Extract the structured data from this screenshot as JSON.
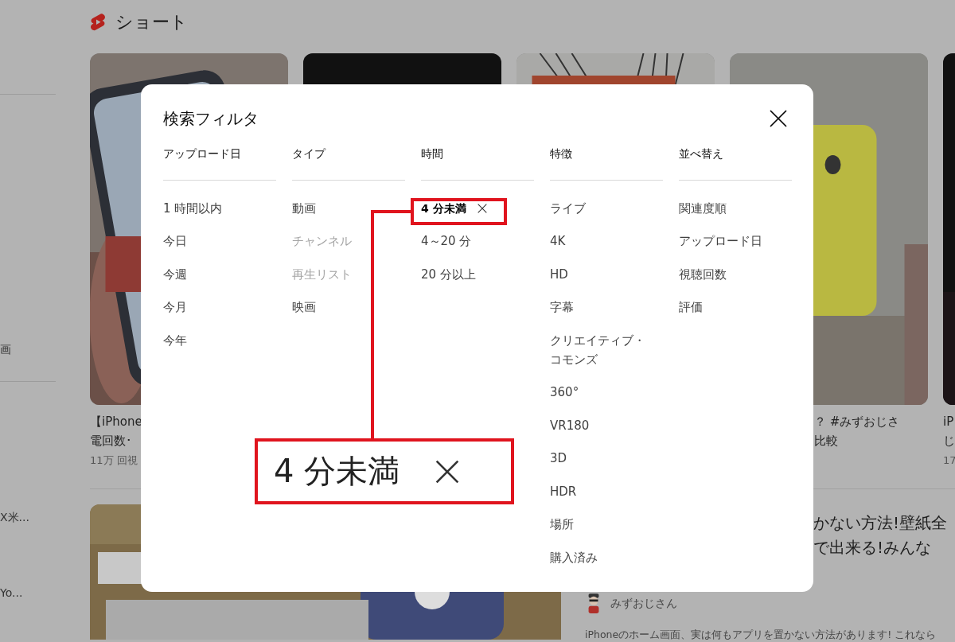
{
  "page": {
    "section_title": "ショート",
    "sidebar": [
      {
        "label": "画"
      },
      {
        "label": "X米..."
      },
      {
        "label": "Yo..."
      }
    ],
    "shorts": [
      {
        "kind": "phone-hand",
        "title_lines": [
          "【iPhone",
          "電回数･"
        ],
        "views": "11万 回視"
      },
      {
        "kind": "dark"
      },
      {
        "kind": "sketch"
      },
      {
        "kind": "yellow-phone",
        "title_lines": [
          "？ #みずおじさ",
          "比較"
        ]
      },
      {
        "kind": "dark",
        "title_lines": [
          "iP",
          "じ"
        ],
        "views": "17"
      }
    ],
    "video": {
      "kind": "poster",
      "title_lines": [
        "かない方法!壁紙全",
        "で出来る!みんな"
      ],
      "channel": "みずおじさん",
      "description": "iPhoneのホーム画面、実は何もアプリを置かない方法があります! これなら"
    }
  },
  "dialog": {
    "title": "検索フィルタ",
    "columns": [
      {
        "heading": "アップロード日",
        "options": [
          {
            "label": "1 時間以内",
            "selected": false,
            "disabled": false
          },
          {
            "label": "今日",
            "selected": false,
            "disabled": false
          },
          {
            "label": "今週",
            "selected": false,
            "disabled": false
          },
          {
            "label": "今月",
            "selected": false,
            "disabled": false
          },
          {
            "label": "今年",
            "selected": false,
            "disabled": false
          }
        ]
      },
      {
        "heading": "タイプ",
        "options": [
          {
            "label": "動画",
            "selected": false,
            "disabled": false
          },
          {
            "label": "チャンネル",
            "selected": false,
            "disabled": true
          },
          {
            "label": "再生リスト",
            "selected": false,
            "disabled": true
          },
          {
            "label": "映画",
            "selected": false,
            "disabled": false
          }
        ]
      },
      {
        "heading": "時間",
        "options": [
          {
            "label": "4 分未満",
            "selected": true,
            "disabled": false
          },
          {
            "label": "4～20 分",
            "selected": false,
            "disabled": false
          },
          {
            "label": "20 分以上",
            "selected": false,
            "disabled": false
          }
        ]
      },
      {
        "heading": "特徴",
        "options": [
          {
            "label": "ライブ",
            "selected": false,
            "disabled": false
          },
          {
            "label": "4K",
            "selected": false,
            "disabled": false
          },
          {
            "label": "HD",
            "selected": false,
            "disabled": false
          },
          {
            "label": "字幕",
            "selected": false,
            "disabled": false
          },
          {
            "label": "クリエイティブ・コモンズ",
            "selected": false,
            "disabled": false
          },
          {
            "label": "360°",
            "selected": false,
            "disabled": false
          },
          {
            "label": "VR180",
            "selected": false,
            "disabled": false
          },
          {
            "label": "3D",
            "selected": false,
            "disabled": false
          },
          {
            "label": "HDR",
            "selected": false,
            "disabled": false
          },
          {
            "label": "場所",
            "selected": false,
            "disabled": false
          },
          {
            "label": "購入済み",
            "selected": false,
            "disabled": false
          }
        ]
      },
      {
        "heading": "並べ替え",
        "options": [
          {
            "label": "関連度順",
            "selected": false,
            "disabled": false
          },
          {
            "label": "アップロード日",
            "selected": false,
            "disabled": false
          },
          {
            "label": "視聴回数",
            "selected": false,
            "disabled": false
          },
          {
            "label": "評価",
            "selected": false,
            "disabled": false
          }
        ]
      }
    ]
  },
  "callout": {
    "text": "4 分未満"
  }
}
